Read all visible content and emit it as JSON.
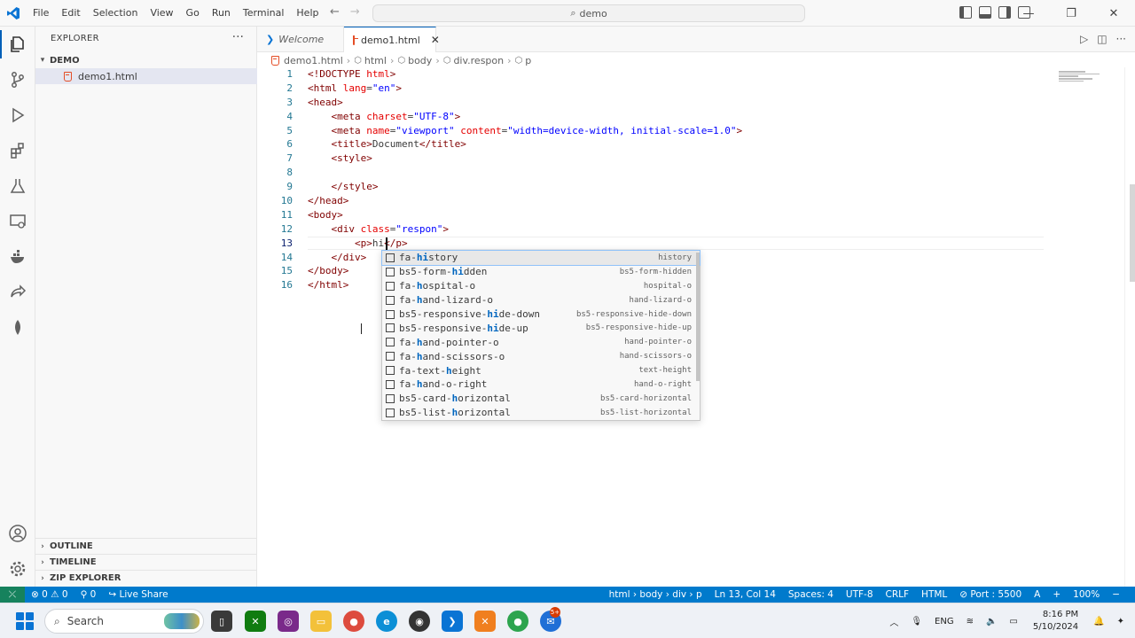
{
  "titlebar": {
    "menu": [
      "File",
      "Edit",
      "Selection",
      "View",
      "Go",
      "Run",
      "Terminal",
      "Help"
    ],
    "command_center": "demo"
  },
  "sidebar": {
    "title": "EXPLORER",
    "folder": "DEMO",
    "file": "demo1.html",
    "panels": [
      "OUTLINE",
      "TIMELINE",
      "ZIP EXPLORER"
    ]
  },
  "tabs": [
    {
      "label": "Welcome",
      "active": false
    },
    {
      "label": "demo1.html",
      "active": true
    }
  ],
  "breadcrumb": [
    "demo1.html",
    "html",
    "body",
    "div.respon",
    "p"
  ],
  "editor": {
    "line_numbers": [
      "1",
      "2",
      "3",
      "4",
      "5",
      "6",
      "7",
      "8",
      "9",
      "10",
      "11",
      "12",
      "13",
      "14",
      "15",
      "16"
    ],
    "current_line": "13",
    "code": {
      "l1_a": "<!DOCTYPE ",
      "l1_b": "html",
      "l1_c": ">",
      "l2_tag": "<html ",
      "l2_attr": "lang",
      "l2_val": "\"en\"",
      "l2_end": ">",
      "l3": "<head>",
      "l4_tag": "<meta ",
      "l4_attr": "charset",
      "l4_val": "\"UTF-8\"",
      "l4_end": ">",
      "l5_tag": "<meta ",
      "l5_attr1": "name",
      "l5_val1": "\"viewport\"",
      "l5_attr2": "content",
      "l5_val2": "\"width=device-width, initial-scale=1.0\"",
      "l5_end": ">",
      "l6_open": "<title>",
      "l6_text": "Document",
      "l6_close": "</title>",
      "l7": "<style>",
      "l9": "</style>",
      "l10": "</head>",
      "l11": "<body>",
      "l12_tag": "<div ",
      "l12_attr": "class",
      "l12_val": "\"respon\"",
      "l12_end": ">",
      "l13_open": "<p>",
      "l13_text": "hi",
      "l13_close": "</p>",
      "l14": "</div>",
      "l15": "</body>",
      "l16": "</html>"
    }
  },
  "suggestions": [
    {
      "pre": "fa-",
      "match": "hi",
      "post": "story",
      "detail": "history"
    },
    {
      "pre": "bs5-form-",
      "match": "hi",
      "post": "dden",
      "detail": "bs5-form-hidden"
    },
    {
      "pre": "fa-",
      "match": "h",
      "post": "ospital-o",
      "detail": "hospital-o"
    },
    {
      "pre": "fa-",
      "match": "h",
      "post": "and-lizard-o",
      "detail": "hand-lizard-o"
    },
    {
      "pre": "bs5-responsive-",
      "match": "hi",
      "post": "de-down",
      "detail": "bs5-responsive-hide-down"
    },
    {
      "pre": "bs5-responsive-",
      "match": "hi",
      "post": "de-up",
      "detail": "bs5-responsive-hide-up"
    },
    {
      "pre": "fa-",
      "match": "h",
      "post": "and-pointer-o",
      "detail": "hand-pointer-o"
    },
    {
      "pre": "fa-",
      "match": "h",
      "post": "and-scissors-o",
      "detail": "hand-scissors-o"
    },
    {
      "pre": "fa-text-",
      "match": "h",
      "post": "eight",
      "detail": "text-height"
    },
    {
      "pre": "fa-",
      "match": "h",
      "post": "and-o-right",
      "detail": "hand-o-right"
    },
    {
      "pre": "bs5-card-",
      "match": "h",
      "post": "orizontal",
      "detail": "bs5-card-horizontal"
    },
    {
      "pre": "bs5-list-",
      "match": "h",
      "post": "orizontal",
      "detail": "bs5-list-horizontal"
    }
  ],
  "statusbar": {
    "problems": "0",
    "warnings": "0",
    "ports": "0",
    "live_share": "Live Share",
    "breadcrumb": "html › body › div › p",
    "position": "Ln 13, Col 14",
    "spaces": "Spaces: 4",
    "encoding": "UTF-8",
    "eol": "CRLF",
    "language": "HTML",
    "port": "Port : 5500",
    "zoom": "100%"
  },
  "taskbar": {
    "search": "Search",
    "lang": "ENG",
    "time": "8:16 PM",
    "date": "5/10/2024",
    "badge": "5+"
  },
  "colors": {
    "accent": "#005fb8",
    "statusbar": "#007acc",
    "remote": "#16825d"
  }
}
